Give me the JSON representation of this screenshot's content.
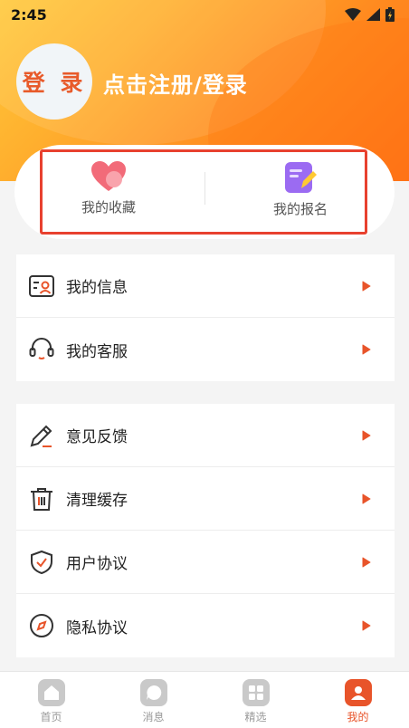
{
  "status_bar": {
    "time": "2:45"
  },
  "profile": {
    "avatar_text": "登 录",
    "login_label": "点击注册/登录"
  },
  "quick_actions": [
    {
      "label": "我的收藏",
      "icon": "heart-icon"
    },
    {
      "label": "我的报名",
      "icon": "signup-form-icon"
    }
  ],
  "menu_groups": [
    [
      {
        "label": "我的信息",
        "icon": "user-card-icon"
      },
      {
        "label": "我的客服",
        "icon": "headset-icon"
      }
    ],
    [
      {
        "label": "意见反馈",
        "icon": "pen-icon"
      },
      {
        "label": "清理缓存",
        "icon": "trash-icon"
      },
      {
        "label": "用户协议",
        "icon": "shield-check-icon"
      },
      {
        "label": "隐私协议",
        "icon": "compass-icon"
      }
    ]
  ],
  "tabbar": [
    {
      "label": "首页",
      "icon": "home-icon",
      "active": false
    },
    {
      "label": "消息",
      "icon": "message-icon",
      "active": false
    },
    {
      "label": "精选",
      "icon": "grid-icon",
      "active": false
    },
    {
      "label": "我的",
      "icon": "profile-icon",
      "active": true
    }
  ],
  "colors": {
    "accent": "#e8542a",
    "highlight_border": "#e8412f",
    "header_gradient_start": "#ffc93a",
    "header_gradient_end": "#ff6f16"
  }
}
